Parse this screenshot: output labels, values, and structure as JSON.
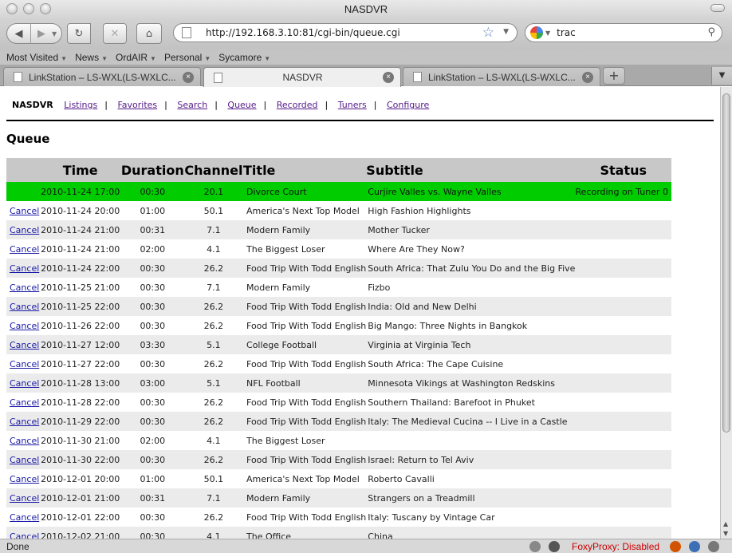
{
  "window": {
    "title": "NASDVR"
  },
  "toolbar": {
    "url": "http://192.168.3.10:81/cgi-bin/queue.cgi",
    "search_query": "trac"
  },
  "bookmarks": [
    {
      "label": "Most Visited"
    },
    {
      "label": "News"
    },
    {
      "label": "OrdAIR"
    },
    {
      "label": "Personal"
    },
    {
      "label": "Sycamore"
    }
  ],
  "tabs": [
    {
      "label": "LinkStation – LS-WXL(LS-WXLC..."
    },
    {
      "label": "NASDVR"
    },
    {
      "label": "LinkStation – LS-WXL(LS-WXLC..."
    }
  ],
  "nav": {
    "brand": "NASDVR",
    "links": [
      "Listings",
      "Favorites",
      "Search",
      "Queue",
      "Recorded",
      "Tuners",
      "Configure"
    ],
    "separator": "|"
  },
  "page": {
    "title": "Queue"
  },
  "table": {
    "headers": [
      "",
      "Time",
      "Duration",
      "Channel",
      "Title",
      "Subtitle",
      "Status"
    ],
    "rows": [
      {
        "action": "",
        "time": "2010-11-24 17:00",
        "duration": "00:30",
        "channel": "20.1",
        "title": "Divorce Court",
        "subtitle": "Curjire Valles vs. Wayne Valles",
        "status": "Recording on Tuner 0",
        "recording": true
      },
      {
        "action": "Cancel",
        "time": "2010-11-24 20:00",
        "duration": "01:00",
        "channel": "50.1",
        "title": "America's Next Top Model",
        "subtitle": "High Fashion Highlights",
        "status": ""
      },
      {
        "action": "Cancel",
        "time": "2010-11-24 21:00",
        "duration": "00:31",
        "channel": "7.1",
        "title": "Modern Family",
        "subtitle": "Mother Tucker",
        "status": ""
      },
      {
        "action": "Cancel",
        "time": "2010-11-24 21:00",
        "duration": "02:00",
        "channel": "4.1",
        "title": "The Biggest Loser",
        "subtitle": "Where Are They Now?",
        "status": ""
      },
      {
        "action": "Cancel",
        "time": "2010-11-24 22:00",
        "duration": "00:30",
        "channel": "26.2",
        "title": "Food Trip With Todd English",
        "subtitle": "South Africa: That Zulu You Do and the Big Five",
        "status": ""
      },
      {
        "action": "Cancel",
        "time": "2010-11-25 21:00",
        "duration": "00:30",
        "channel": "7.1",
        "title": "Modern Family",
        "subtitle": "Fizbo",
        "status": ""
      },
      {
        "action": "Cancel",
        "time": "2010-11-25 22:00",
        "duration": "00:30",
        "channel": "26.2",
        "title": "Food Trip With Todd English",
        "subtitle": "India: Old and New Delhi",
        "status": ""
      },
      {
        "action": "Cancel",
        "time": "2010-11-26 22:00",
        "duration": "00:30",
        "channel": "26.2",
        "title": "Food Trip With Todd English",
        "subtitle": "Big Mango: Three Nights in Bangkok",
        "status": ""
      },
      {
        "action": "Cancel",
        "time": "2010-11-27 12:00",
        "duration": "03:30",
        "channel": "5.1",
        "title": "College Football",
        "subtitle": "Virginia at Virginia Tech",
        "status": ""
      },
      {
        "action": "Cancel",
        "time": "2010-11-27 22:00",
        "duration": "00:30",
        "channel": "26.2",
        "title": "Food Trip With Todd English",
        "subtitle": "South Africa: The Cape Cuisine",
        "status": ""
      },
      {
        "action": "Cancel",
        "time": "2010-11-28 13:00",
        "duration": "03:00",
        "channel": "5.1",
        "title": "NFL Football",
        "subtitle": "Minnesota Vikings at Washington Redskins",
        "status": ""
      },
      {
        "action": "Cancel",
        "time": "2010-11-28 22:00",
        "duration": "00:30",
        "channel": "26.2",
        "title": "Food Trip With Todd English",
        "subtitle": "Southern Thailand: Barefoot in Phuket",
        "status": ""
      },
      {
        "action": "Cancel",
        "time": "2010-11-29 22:00",
        "duration": "00:30",
        "channel": "26.2",
        "title": "Food Trip With Todd English",
        "subtitle": "Italy: The Medieval Cucina -- I Live in a Castle",
        "status": ""
      },
      {
        "action": "Cancel",
        "time": "2010-11-30 21:00",
        "duration": "02:00",
        "channel": "4.1",
        "title": "The Biggest Loser",
        "subtitle": "",
        "status": ""
      },
      {
        "action": "Cancel",
        "time": "2010-11-30 22:00",
        "duration": "00:30",
        "channel": "26.2",
        "title": "Food Trip With Todd English",
        "subtitle": "Israel: Return to Tel Aviv",
        "status": ""
      },
      {
        "action": "Cancel",
        "time": "2010-12-01 20:00",
        "duration": "01:00",
        "channel": "50.1",
        "title": "America's Next Top Model",
        "subtitle": "Roberto Cavalli",
        "status": ""
      },
      {
        "action": "Cancel",
        "time": "2010-12-01 21:00",
        "duration": "00:31",
        "channel": "7.1",
        "title": "Modern Family",
        "subtitle": "Strangers on a Treadmill",
        "status": ""
      },
      {
        "action": "Cancel",
        "time": "2010-12-01 22:00",
        "duration": "00:30",
        "channel": "26.2",
        "title": "Food Trip With Todd English",
        "subtitle": "Italy: Tuscany by Vintage Car",
        "status": ""
      },
      {
        "action": "Cancel",
        "time": "2010-12-02 21:00",
        "duration": "00:30",
        "channel": "4.1",
        "title": "The Office",
        "subtitle": "China",
        "status": ""
      }
    ]
  },
  "statusbar": {
    "text": "Done",
    "foxyproxy": "FoxyProxy: Disabled"
  },
  "colors": {
    "recording_row": "#00cc00",
    "header_bg": "#c8c8c8",
    "stripe_bg": "#ebebeb",
    "link": "#551a8b"
  }
}
